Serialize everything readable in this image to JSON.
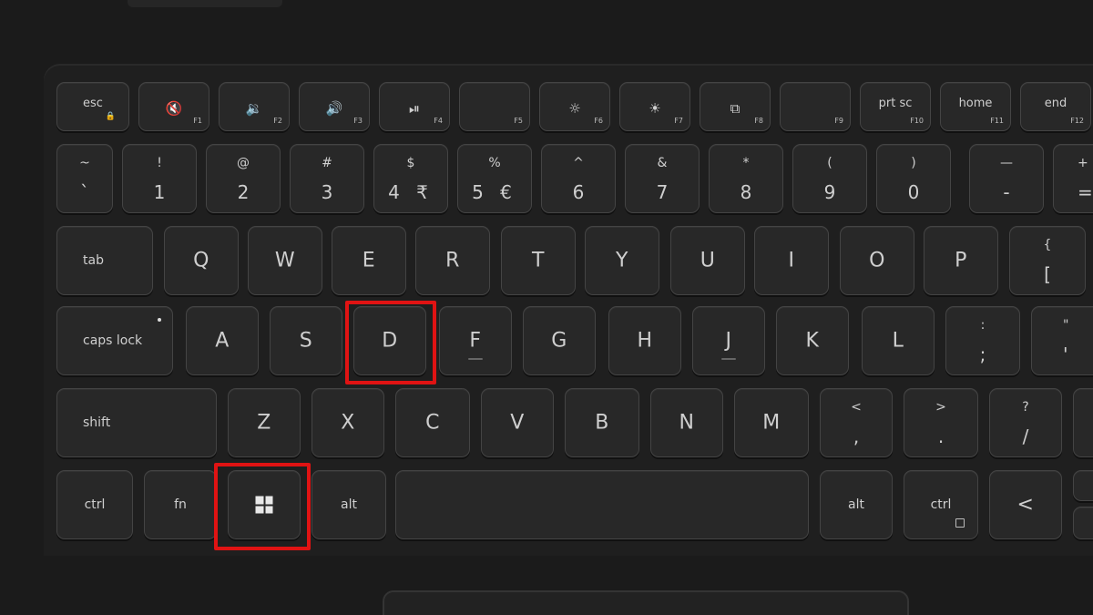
{
  "keyboard": {
    "highlight_color": "#e01313",
    "function_row": [
      {
        "label": "esc"
      },
      {
        "icon": "mute-speaker-icon",
        "glyph": "🔇",
        "fn": "F1"
      },
      {
        "icon": "volume-down-icon",
        "glyph": "🔉",
        "fn": "F2"
      },
      {
        "icon": "volume-up-icon",
        "glyph": "🔊",
        "fn": "F3"
      },
      {
        "icon": "play-pause-icon",
        "glyph": "⏯",
        "fn": "F4"
      },
      {
        "fn": "F5"
      },
      {
        "icon": "brightness-down-icon",
        "glyph": "☼",
        "fn": "F6"
      },
      {
        "icon": "brightness-up-icon",
        "glyph": "☀",
        "fn": "F7"
      },
      {
        "icon": "display-switch-icon",
        "glyph": "⧉",
        "fn": "F8"
      },
      {
        "fn": "F9"
      },
      {
        "label": "prt sc",
        "fn": "F10"
      },
      {
        "label": "home",
        "fn": "F11"
      },
      {
        "label": "end",
        "fn": "F12"
      }
    ],
    "number_row": [
      {
        "upper": "~",
        "lower": "`"
      },
      {
        "upper": "!",
        "lower": "1"
      },
      {
        "upper": "@",
        "lower": "2"
      },
      {
        "upper": "#",
        "lower": "3"
      },
      {
        "upper": "$",
        "lower": "4 ₹"
      },
      {
        "upper": "%",
        "lower": "5 €"
      },
      {
        "upper": "^",
        "lower": "6"
      },
      {
        "upper": "&",
        "lower": "7"
      },
      {
        "upper": "*",
        "lower": "8"
      },
      {
        "upper": "(",
        "lower": "9"
      },
      {
        "upper": ")",
        "lower": "0"
      },
      {
        "upper": "—",
        "lower": "-"
      },
      {
        "upper": "+",
        "lower": "="
      }
    ],
    "qwerty_row": {
      "tab": "tab",
      "letters": [
        "Q",
        "W",
        "E",
        "R",
        "T",
        "Y",
        "U",
        "I",
        "O",
        "P"
      ],
      "brace": {
        "upper": "{",
        "lower": "["
      }
    },
    "home_row": {
      "caps": "caps lock",
      "letters": [
        "A",
        "S",
        "D",
        "F",
        "G",
        "H",
        "J",
        "K",
        "L"
      ],
      "semicolon": {
        "upper": ":",
        "lower": ";"
      },
      "quote": {
        "upper": "\"",
        "lower": "'"
      }
    },
    "shift_row": {
      "shift": "shift",
      "letters": [
        "Z",
        "X",
        "C",
        "V",
        "B",
        "N",
        "M"
      ],
      "comma": {
        "upper": "<",
        "lower": ","
      },
      "period": {
        "upper": ">",
        "lower": "."
      },
      "slash": {
        "upper": "?",
        "lower": "/"
      }
    },
    "bottom_row": {
      "ctrl_left": "ctrl",
      "fn": "fn",
      "alt_left": "alt",
      "alt_right": "alt",
      "ctrl_right": "ctrl",
      "left_arrow": "<"
    }
  }
}
